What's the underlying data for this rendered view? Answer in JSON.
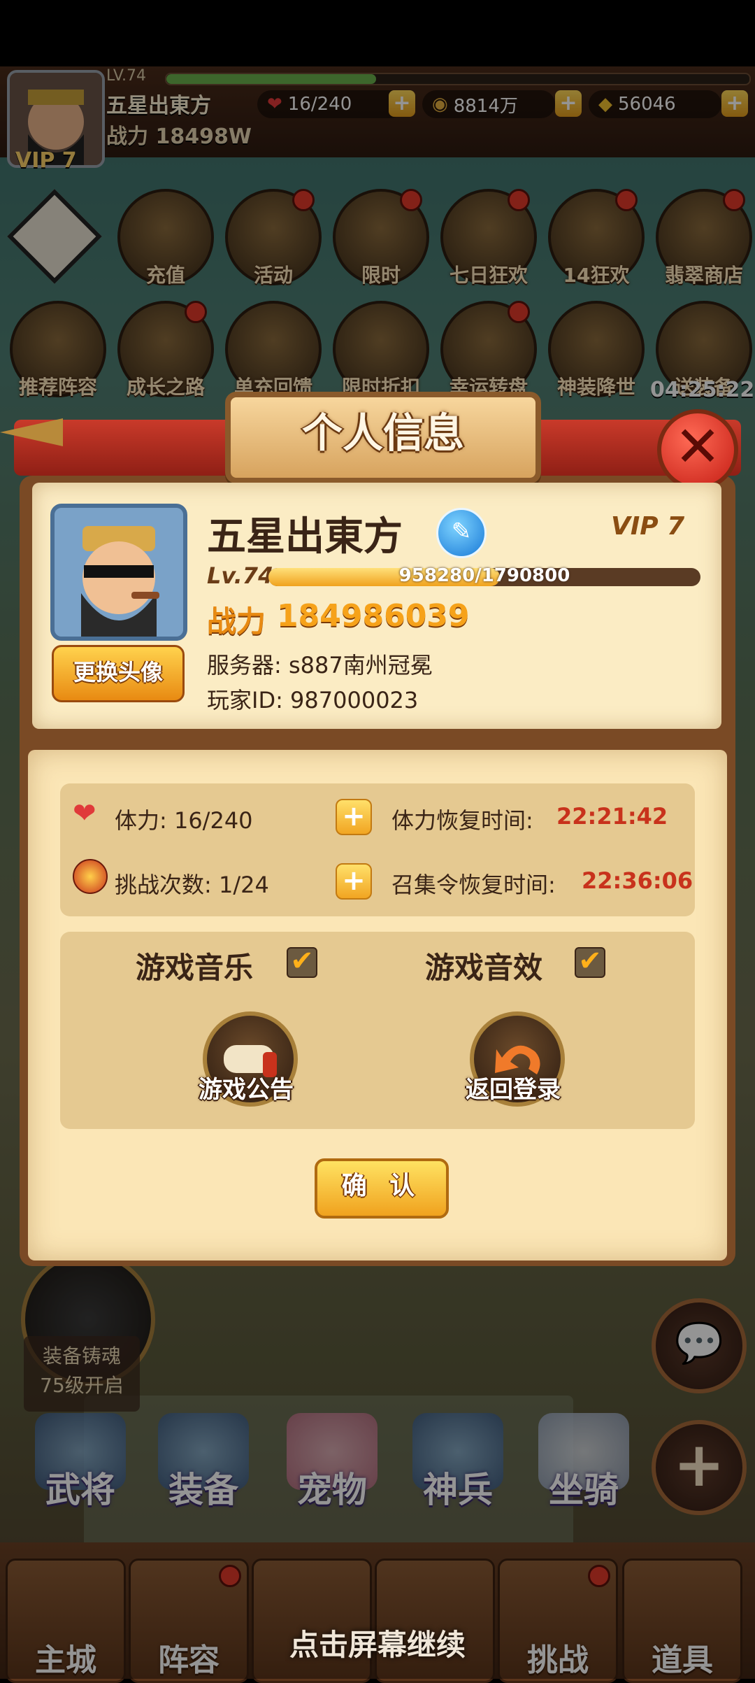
{
  "hud": {
    "level": "LV.74",
    "name": "五星出東方",
    "power": "战力 18498W",
    "vip": "VIP 7",
    "stamina": "16/240",
    "copper": "8814万",
    "gold": "56046"
  },
  "activities_row1": [
    "充值",
    "活动",
    "限时",
    "七日狂欢",
    "14狂欢",
    "翡翠商店"
  ],
  "activities_row2": [
    "推荐阵容",
    "成长之路",
    "单充回馈",
    "限时折扣",
    "幸运转盘",
    "神装降世",
    "送装备"
  ],
  "timer": "04:25:22",
  "modal": {
    "title": "个人信息",
    "player_name": "五星出東方",
    "vip": "VIP 7",
    "level": "Lv.74",
    "exp": "958280/1790800",
    "exp_fraction": 0.535,
    "power_label": "战力",
    "power": "184986039",
    "server": "服务器:  s887南州冠冕",
    "player_id": "玩家ID:  987000023",
    "change_avatar": "更换头像",
    "stamina_label": "体力:  16/240",
    "stamina_recover_label": "体力恢复时间:",
    "stamina_recover_time": "22:21:42",
    "challenge_label": "挑战次数:  1/24",
    "summon_recover_label": "召集令恢复时间:",
    "summon_recover_time": "22:36:06",
    "music_label": "游戏音乐",
    "sfx_label": "游戏音效",
    "notice_label": "游戏公告",
    "logout_label": "返回登录",
    "confirm": "确 认"
  },
  "forge": {
    "line1": "装备铸魂",
    "line2": "75级开启"
  },
  "features": [
    "武将",
    "装备",
    "宠物",
    "神兵",
    "坐骑"
  ],
  "tabs": [
    "主城",
    "阵容",
    "",
    "",
    "挑战",
    "道具"
  ],
  "continue_text": "点击屏幕继续"
}
